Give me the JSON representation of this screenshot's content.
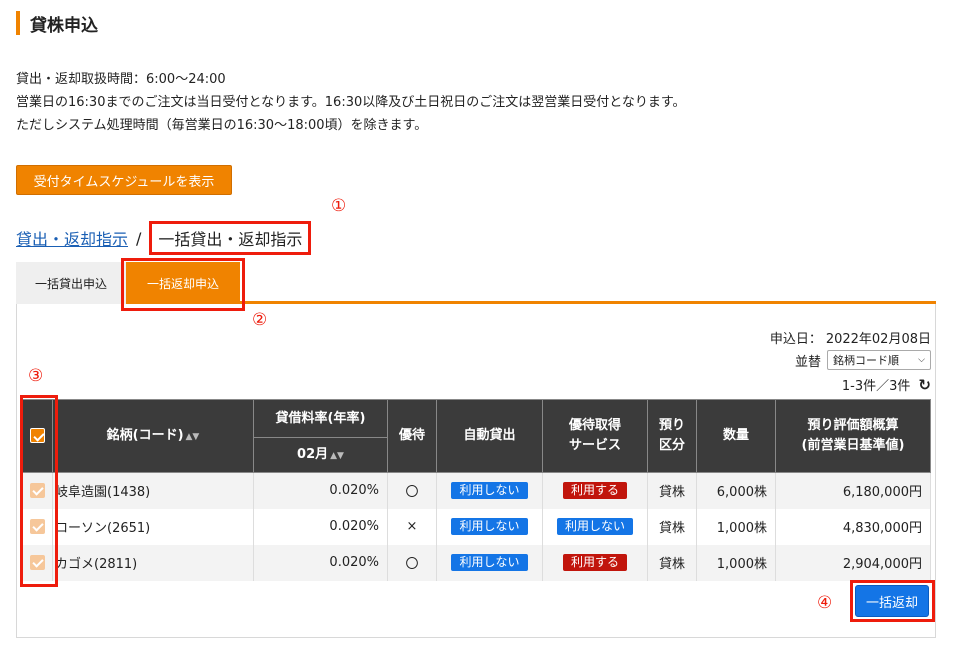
{
  "page": {
    "title": "貸株申込"
  },
  "notes": [
    "貸出・返却取扱時間：6:00〜24:00",
    "営業日の16:30までのご注文は当日受付となります。16:30以降及び土日祝日のご注文は翌営業日受付となります。",
    "ただしシステム処理時間（毎営業日の16:30〜18:00頃）を除きます。"
  ],
  "schedule_button": "受付タイムスケジュールを表示",
  "breadcrumb": {
    "link": "貸出・返却指示",
    "separator": "/",
    "current": "一括貸出・返却指示"
  },
  "annotations": {
    "a1": "①",
    "a2": "②",
    "a3": "③",
    "a4": "④"
  },
  "tabs": {
    "lend": "一括貸出申込",
    "return": "一括返却申込"
  },
  "meta": {
    "date_label": "申込日：",
    "date_value": "2022年02月08日",
    "sort_label": "並替",
    "sort_value": "銘柄コード順",
    "count": "1-3件／3件"
  },
  "table": {
    "headers": {
      "name": "銘柄(コード)",
      "rate": "貸借料率(年率)",
      "rate_month": "02月",
      "benefit": "優待",
      "auto": "自動貸出",
      "service_1": "優待取得",
      "service_2": "サービス",
      "type_1": "預り",
      "type_2": "区分",
      "qty": "数量",
      "value_1": "預り評価額概算",
      "value_2": "(前営業日基準値)"
    },
    "rows": [
      {
        "name": "岐阜造園(1438)",
        "rate": "0.020%",
        "benefit": "〇",
        "auto": "利用しない",
        "service": "利用する",
        "type": "貸株",
        "qty": "6,000株",
        "value": "6,180,000円"
      },
      {
        "name": "ローソン(2651)",
        "rate": "0.020%",
        "benefit": "×",
        "auto": "利用しない",
        "service": "利用しない",
        "type": "貸株",
        "qty": "1,000株",
        "value": "4,830,000円"
      },
      {
        "name": "カゴメ(2811)",
        "rate": "0.020%",
        "benefit": "〇",
        "auto": "利用しない",
        "service": "利用する",
        "type": "貸株",
        "qty": "1,000株",
        "value": "2,904,000円"
      }
    ]
  },
  "return_button": "一括返却",
  "colors": {
    "accent": "#f08300",
    "highlight": "#ee1c0c",
    "blue": "#1475e6",
    "red": "#c1150c",
    "header": "#3b3b3b"
  }
}
